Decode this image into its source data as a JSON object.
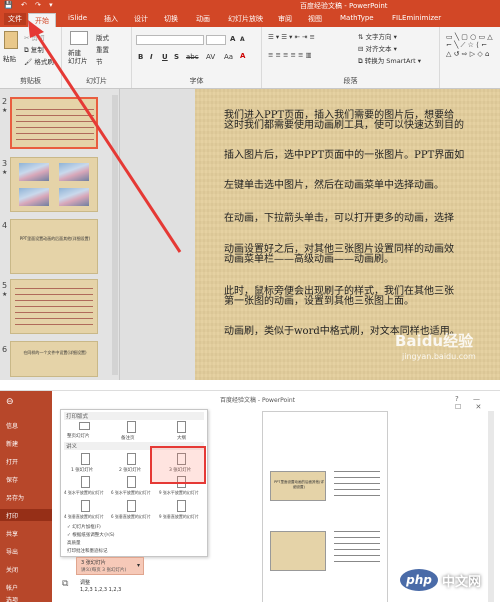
{
  "top": {
    "window_title": "百度经验文稿 - PowerPoint",
    "tabs": [
      "文件",
      "开始",
      "iSlide",
      "插入",
      "设计",
      "切换",
      "动画",
      "幻灯片放映",
      "审阅",
      "视图",
      "MathType",
      "FILEminimizer"
    ],
    "active_tab_index": 1,
    "ribbon": {
      "clipboard": {
        "paste": "粘贴",
        "cut": "剪切",
        "copy": "复制",
        "format_painter": "格式刷",
        "label": "剪贴板"
      },
      "slides": {
        "new_slide": "新建\n幻灯片",
        "layout": "版式",
        "reset": "重置",
        "section": "节",
        "label": "幻灯片"
      },
      "font": {
        "label": "字体",
        "bold": "B",
        "italic": "I",
        "underline": "U",
        "strike": "S",
        "abc": "abc",
        "av": "AV",
        "aa": "Aa",
        "grow": "A",
        "shrink": "A"
      },
      "paragraph": {
        "label": "段落",
        "text_direction": "文字方向",
        "align_text": "对齐文本",
        "smartart": "转换为 SmartArt"
      }
    },
    "thumbnails": [
      {
        "num": "2",
        "star": "★",
        "caption": ""
      },
      {
        "num": "3",
        "star": "★",
        "caption": ""
      },
      {
        "num": "4",
        "star": "",
        "caption": "PPT里面设置动画的后面其他(详细设置)"
      },
      {
        "num": "5",
        "star": "★",
        "caption": ""
      },
      {
        "num": "6",
        "star": "",
        "caption": "在同样的一个文件中设置(详细设置)"
      }
    ],
    "slide_text": [
      "我们进入PPT页面，插入我们需要的图片后，想要给",
      "这时我们都需要使用动画刷工具，使可以快速达到目的",
      "插入图片后，选中PPT页面中的一张图片。PPT界面如",
      "左键单击选中图片，然后在动画菜单中选择动画。",
      "在动画，下拉箭头单击，可以打开更多的动画，选择",
      "动画设置好之后，对其他三张图片设置同样的动画效",
      "动画菜单栏——高级动画——动画刷。",
      "此时，鼠标旁便会出现刷子的样式，我们在其他三张",
      "第一张图的动画，设置到其他三张图上面。",
      "动画刷，类似于word中格式刷，对文本同样也适用。"
    ],
    "watermark": "Baidu经验",
    "watermark_sub": "jingyan.baidu.com"
  },
  "bottom": {
    "window_title": "百度经验文稿 - PowerPoint",
    "backstage": [
      "信息",
      "新建",
      "打开",
      "保存",
      "另存为",
      "打印",
      "共享",
      "导出",
      "关闭",
      "帐户",
      "选项"
    ],
    "active_backstage_index": 5,
    "dropdown": {
      "section1": "打印版式",
      "layouts": [
        "整页幻灯片",
        "备注页",
        "大纲"
      ],
      "section2": "讲义",
      "handouts": [
        "1 张幻灯片",
        "2 张幻灯片",
        "3 张幻灯片",
        "4 张水平放置的幻灯片",
        "6 张水平放置的幻灯片",
        "9 张水平放置的幻灯片",
        "4 张垂直放置的幻灯片",
        "6 张垂直放置的幻灯片",
        "9 张垂直放置的幻灯片"
      ],
      "options": [
        "✓ 幻灯片加框(F)",
        "✓ 根据纸张调整大小(S)",
        "高质量",
        "打印批注和墨迹标记"
      ]
    },
    "selected_layout": {
      "title": "3 张幻灯片",
      "subtitle": "讲义(每页 3 张幻灯片)"
    },
    "collate": {
      "label": "调整",
      "value": "1,2,3   1,2,3   1,2,3"
    },
    "preview_caption1": "PPT里面设置动画的后面其他(详细设置)",
    "watermark": "中文网",
    "watermark_logo": "php"
  },
  "colors": {
    "accent": "#d24726",
    "highlight_box": "#e53935"
  }
}
